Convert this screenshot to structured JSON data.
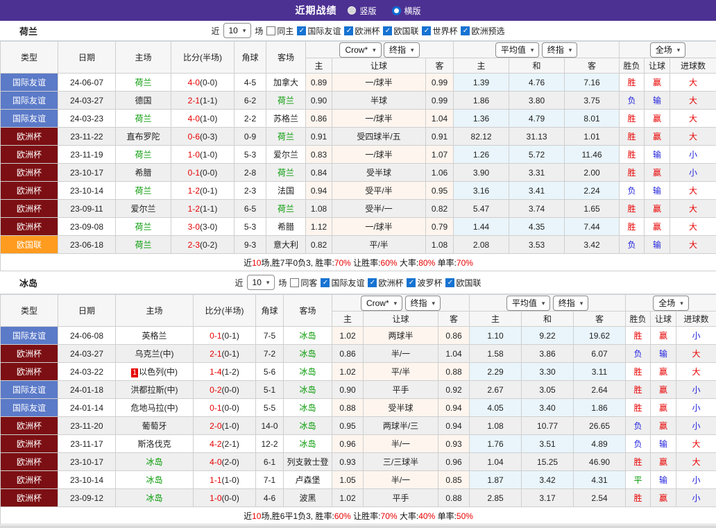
{
  "topbar": {
    "title": "近期战绩",
    "options": [
      {
        "label": "竖版",
        "selected": false
      },
      {
        "label": "横版",
        "selected": true
      }
    ]
  },
  "labels": {
    "near": "近",
    "games": "场",
    "col_type": "类型",
    "col_date": "日期",
    "col_home": "主场",
    "col_score": "比分(半场)",
    "col_corner": "角球",
    "col_away": "客场",
    "sub_home": "主",
    "sub_handicap": "让球",
    "sub_away": "客",
    "sub_avg_home": "主",
    "sub_avg_draw": "和",
    "sub_avg_away": "客",
    "sub_wdl": "胜负",
    "sub_let": "让球",
    "sub_goals": "进球数",
    "sum_near": "近",
    "sum_games": "场,",
    "sum_win": "胜率:",
    "sum_let": "让胜率:",
    "sum_big": "大率:",
    "sum_single": "单率:"
  },
  "colors": {
    "accent_purple": "#4d3192",
    "badge_friendly": "#5b7ac8",
    "badge_eurocup": "#7c0f13",
    "badge_nations": "#ff9b1e",
    "team_green": "#009900",
    "win_red": "#e80000",
    "lose_blue": "#2222dd"
  },
  "sections": [
    {
      "team": "荷兰",
      "filter": {
        "count": "10",
        "same_label": "同主",
        "same_checked": false,
        "leagues": [
          {
            "label": "国际友谊",
            "checked": true
          },
          {
            "label": "欧洲杯",
            "checked": true
          },
          {
            "label": "欧国联",
            "checked": true
          },
          {
            "label": "世界杯",
            "checked": true
          },
          {
            "label": "欧洲预选",
            "checked": true
          }
        ]
      },
      "selects": {
        "odds_source": "Crow*",
        "odds_final": "终指",
        "average": "平均值",
        "average_final": "终指",
        "full": "全场"
      },
      "rows": [
        {
          "type": "国际友谊",
          "date": "24-06-07",
          "home": "荷兰",
          "red_card": "",
          "score": "4-0",
          "half": "(0-0)",
          "corner": "4-5",
          "away": "加拿大",
          "odds": [
            "0.89",
            "一/球半",
            "0.99"
          ],
          "avg": [
            "1.39",
            "4.76",
            "7.16"
          ],
          "results": [
            "胜",
            "赢",
            "大"
          ]
        },
        {
          "type": "国际友谊",
          "date": "24-03-27",
          "home": "德国",
          "red_card": "",
          "score": "2-1",
          "half": "(1-1)",
          "corner": "6-2",
          "away": "荷兰",
          "odds": [
            "0.90",
            "半球",
            "0.99"
          ],
          "avg": [
            "1.86",
            "3.80",
            "3.75"
          ],
          "results": [
            "负",
            "输",
            "大"
          ]
        },
        {
          "type": "国际友谊",
          "date": "24-03-23",
          "home": "荷兰",
          "red_card": "",
          "score": "4-0",
          "half": "(1-0)",
          "corner": "2-2",
          "away": "苏格兰",
          "odds": [
            "0.86",
            "一/球半",
            "1.04"
          ],
          "avg": [
            "1.36",
            "4.79",
            "8.01"
          ],
          "results": [
            "胜",
            "赢",
            "大"
          ]
        },
        {
          "type": "欧洲杯",
          "date": "23-11-22",
          "home": "直布罗陀",
          "red_card": "",
          "score": "0-6",
          "half": "(0-3)",
          "corner": "0-9",
          "away": "荷兰",
          "odds": [
            "0.91",
            "受四球半/五",
            "0.91"
          ],
          "avg": [
            "82.12",
            "31.13",
            "1.01"
          ],
          "results": [
            "胜",
            "赢",
            "大"
          ]
        },
        {
          "type": "欧洲杯",
          "date": "23-11-19",
          "home": "荷兰",
          "red_card": "",
          "score": "1-0",
          "half": "(1-0)",
          "corner": "5-3",
          "away": "爱尔兰",
          "odds": [
            "0.83",
            "一/球半",
            "1.07"
          ],
          "avg": [
            "1.26",
            "5.72",
            "11.46"
          ],
          "results": [
            "胜",
            "输",
            "小"
          ]
        },
        {
          "type": "欧洲杯",
          "date": "23-10-17",
          "home": "希腊",
          "red_card": "",
          "score": "0-1",
          "half": "(0-0)",
          "corner": "2-8",
          "away": "荷兰",
          "odds": [
            "0.84",
            "受半球",
            "1.06"
          ],
          "avg": [
            "3.90",
            "3.31",
            "2.00"
          ],
          "results": [
            "胜",
            "赢",
            "小"
          ]
        },
        {
          "type": "欧洲杯",
          "date": "23-10-14",
          "home": "荷兰",
          "red_card": "",
          "score": "1-2",
          "half": "(0-1)",
          "corner": "2-3",
          "away": "法国",
          "odds": [
            "0.94",
            "受平/半",
            "0.95"
          ],
          "avg": [
            "3.16",
            "3.41",
            "2.24"
          ],
          "results": [
            "负",
            "输",
            "大"
          ]
        },
        {
          "type": "欧洲杯",
          "date": "23-09-11",
          "home": "爱尔兰",
          "red_card": "",
          "score": "1-2",
          "half": "(1-1)",
          "corner": "6-5",
          "away": "荷兰",
          "odds": [
            "1.08",
            "受半/一",
            "0.82"
          ],
          "avg": [
            "5.47",
            "3.74",
            "1.65"
          ],
          "results": [
            "胜",
            "赢",
            "大"
          ]
        },
        {
          "type": "欧洲杯",
          "date": "23-09-08",
          "home": "荷兰",
          "red_card": "",
          "score": "3-0",
          "half": "(3-0)",
          "corner": "5-3",
          "away": "希腊",
          "odds": [
            "1.12",
            "一/球半",
            "0.79"
          ],
          "avg": [
            "1.44",
            "4.35",
            "7.44"
          ],
          "results": [
            "胜",
            "赢",
            "大"
          ]
        },
        {
          "type": "欧国联",
          "date": "23-06-18",
          "home": "荷兰",
          "red_card": "",
          "score": "2-3",
          "half": "(0-2)",
          "corner": "9-3",
          "away": "意大利",
          "odds": [
            "0.82",
            "平/半",
            "1.08"
          ],
          "avg": [
            "2.08",
            "3.53",
            "3.42"
          ],
          "results": [
            "负",
            "输",
            "大"
          ]
        }
      ],
      "summary": {
        "games": "10",
        "record": "胜7平0负3",
        "win_rate": "70%",
        "let_rate": "60%",
        "big_rate": "80%",
        "single_rate": "70%"
      }
    },
    {
      "team": "冰岛",
      "filter": {
        "count": "10",
        "same_label": "同客",
        "same_checked": false,
        "leagues": [
          {
            "label": "国际友谊",
            "checked": true
          },
          {
            "label": "欧洲杯",
            "checked": true
          },
          {
            "label": "波罗杯",
            "checked": true
          },
          {
            "label": "欧国联",
            "checked": true
          }
        ]
      },
      "selects": {
        "odds_source": "Crow*",
        "odds_final": "终指",
        "average": "平均值",
        "average_final": "终指",
        "full": "全场"
      },
      "rows": [
        {
          "type": "国际友谊",
          "date": "24-06-08",
          "home": "英格兰",
          "red_card": "",
          "score": "0-1",
          "half": "(0-1)",
          "corner": "7-5",
          "away": "冰岛",
          "odds": [
            "1.02",
            "两球半",
            "0.86"
          ],
          "avg": [
            "1.10",
            "9.22",
            "19.62"
          ],
          "results": [
            "胜",
            "赢",
            "小"
          ]
        },
        {
          "type": "欧洲杯",
          "date": "24-03-27",
          "home": "乌克兰(中)",
          "red_card": "",
          "score": "2-1",
          "half": "(0-1)",
          "corner": "7-2",
          "away": "冰岛",
          "odds": [
            "0.86",
            "半/一",
            "1.04"
          ],
          "avg": [
            "1.58",
            "3.86",
            "6.07"
          ],
          "results": [
            "负",
            "输",
            "大"
          ]
        },
        {
          "type": "欧洲杯",
          "date": "24-03-22",
          "home": "以色列(中)",
          "red_card": "1",
          "score": "1-4",
          "half": "(1-2)",
          "corner": "5-6",
          "away": "冰岛",
          "odds": [
            "1.02",
            "平/半",
            "0.88"
          ],
          "avg": [
            "2.29",
            "3.30",
            "3.11"
          ],
          "results": [
            "胜",
            "赢",
            "大"
          ]
        },
        {
          "type": "国际友谊",
          "date": "24-01-18",
          "home": "洪都拉斯(中)",
          "red_card": "",
          "score": "0-2",
          "half": "(0-0)",
          "corner": "5-1",
          "away": "冰岛",
          "odds": [
            "0.90",
            "平手",
            "0.92"
          ],
          "avg": [
            "2.67",
            "3.05",
            "2.64"
          ],
          "results": [
            "胜",
            "赢",
            "小"
          ]
        },
        {
          "type": "国际友谊",
          "date": "24-01-14",
          "home": "危地马拉(中)",
          "red_card": "",
          "score": "0-1",
          "half": "(0-0)",
          "corner": "5-5",
          "away": "冰岛",
          "odds": [
            "0.88",
            "受半球",
            "0.94"
          ],
          "avg": [
            "4.05",
            "3.40",
            "1.86"
          ],
          "results": [
            "胜",
            "赢",
            "小"
          ]
        },
        {
          "type": "欧洲杯",
          "date": "23-11-20",
          "home": "葡萄牙",
          "red_card": "",
          "score": "2-0",
          "half": "(1-0)",
          "corner": "14-0",
          "away": "冰岛",
          "odds": [
            "0.95",
            "两球半/三",
            "0.94"
          ],
          "avg": [
            "1.08",
            "10.77",
            "26.65"
          ],
          "results": [
            "负",
            "赢",
            "小"
          ]
        },
        {
          "type": "欧洲杯",
          "date": "23-11-17",
          "home": "斯洛伐克",
          "red_card": "",
          "score": "4-2",
          "half": "(2-1)",
          "corner": "12-2",
          "away": "冰岛",
          "odds": [
            "0.96",
            "半/一",
            "0.93"
          ],
          "avg": [
            "1.76",
            "3.51",
            "4.89"
          ],
          "results": [
            "负",
            "输",
            "大"
          ]
        },
        {
          "type": "欧洲杯",
          "date": "23-10-17",
          "home": "冰岛",
          "red_card": "",
          "score": "4-0",
          "half": "(2-0)",
          "corner": "6-1",
          "away": "列支敦士登",
          "odds": [
            "0.93",
            "三/三球半",
            "0.96"
          ],
          "avg": [
            "1.04",
            "15.25",
            "46.90"
          ],
          "results": [
            "胜",
            "赢",
            "大"
          ]
        },
        {
          "type": "欧洲杯",
          "date": "23-10-14",
          "home": "冰岛",
          "red_card": "",
          "score": "1-1",
          "half": "(1-0)",
          "corner": "7-1",
          "away": "卢森堡",
          "odds": [
            "1.05",
            "半/一",
            "0.85"
          ],
          "avg": [
            "1.87",
            "3.42",
            "4.31"
          ],
          "results": [
            "平",
            "输",
            "小"
          ]
        },
        {
          "type": "欧洲杯",
          "date": "23-09-12",
          "home": "冰岛",
          "red_card": "",
          "score": "1-0",
          "half": "(0-0)",
          "corner": "4-6",
          "away": "波黑",
          "odds": [
            "1.02",
            "平手",
            "0.88"
          ],
          "avg": [
            "2.85",
            "3.17",
            "2.54"
          ],
          "results": [
            "胜",
            "赢",
            "小"
          ]
        }
      ],
      "summary": {
        "games": "10",
        "record": "胜6平1负3",
        "win_rate": "60%",
        "let_rate": "70%",
        "big_rate": "40%",
        "single_rate": "50%"
      }
    }
  ]
}
